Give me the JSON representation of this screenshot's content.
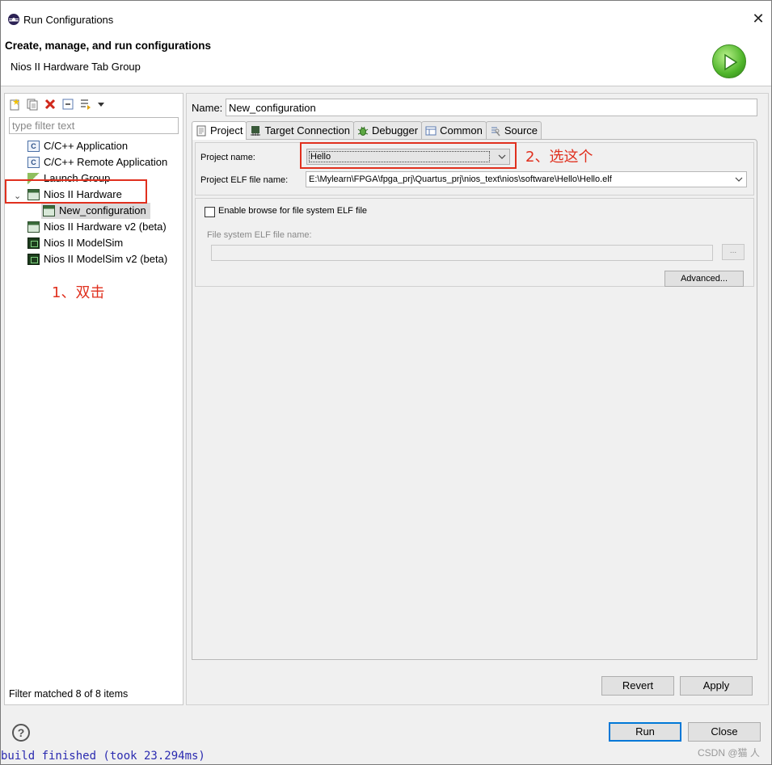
{
  "window": {
    "title": "Run Configurations",
    "close_glyph": "✕"
  },
  "header": {
    "title": "Create, manage, and run configurations",
    "subtitle": "Nios II Hardware Tab Group"
  },
  "left": {
    "filter_placeholder": "type filter text",
    "tree": [
      {
        "label": "C/C++ Application",
        "icon": "c-app-icon"
      },
      {
        "label": "C/C++ Remote Application",
        "icon": "c-remote-icon"
      },
      {
        "label": "Launch Group",
        "icon": "launch-group-icon"
      },
      {
        "label": "Nios II Hardware",
        "icon": "nios-hardware-icon",
        "expanded": true
      },
      {
        "label": "New_configuration",
        "icon": "nios-config-icon",
        "selected": true
      },
      {
        "label": "Nios II Hardware v2 (beta)",
        "icon": "nios-hardware-icon"
      },
      {
        "label": "Nios II ModelSim",
        "icon": "modelsim-icon"
      },
      {
        "label": "Nios II ModelSim v2 (beta)",
        "icon": "modelsim-icon"
      }
    ],
    "status": "Filter matched 8 of 8 items"
  },
  "annotations": {
    "step1": "1、双击",
    "step2": "2、选这个"
  },
  "right": {
    "name_label": "Name:",
    "name_value": "New_configuration",
    "tabs": [
      "Project",
      "Target Connection",
      "Debugger",
      "Common",
      "Source"
    ],
    "active_tab": "Project",
    "project_name_label": "Project name:",
    "project_name_value": "Hello",
    "elf_label": "Project ELF file name:",
    "elf_value": "E:\\Mylearn\\FPGA\\fpga_prj\\Quartus_prj\\nios_text\\nios\\software\\Hello\\Hello.elf",
    "enable_browse_label": "Enable browse for file system ELF file",
    "enable_browse_checked": false,
    "fs_elf_label": "File system ELF file name:",
    "fs_elf_value": "",
    "browse_label": "...",
    "advanced_label": "Advanced...",
    "revert_label": "Revert",
    "apply_label": "Apply"
  },
  "footer": {
    "help_glyph": "?",
    "run_label": "Run",
    "close_label": "Close",
    "console_text": "build finished (took 23.294ms)",
    "watermark": "CSDN @猫 人"
  },
  "colors": {
    "annotation": "#e0301e",
    "accent": "#0078d7"
  }
}
